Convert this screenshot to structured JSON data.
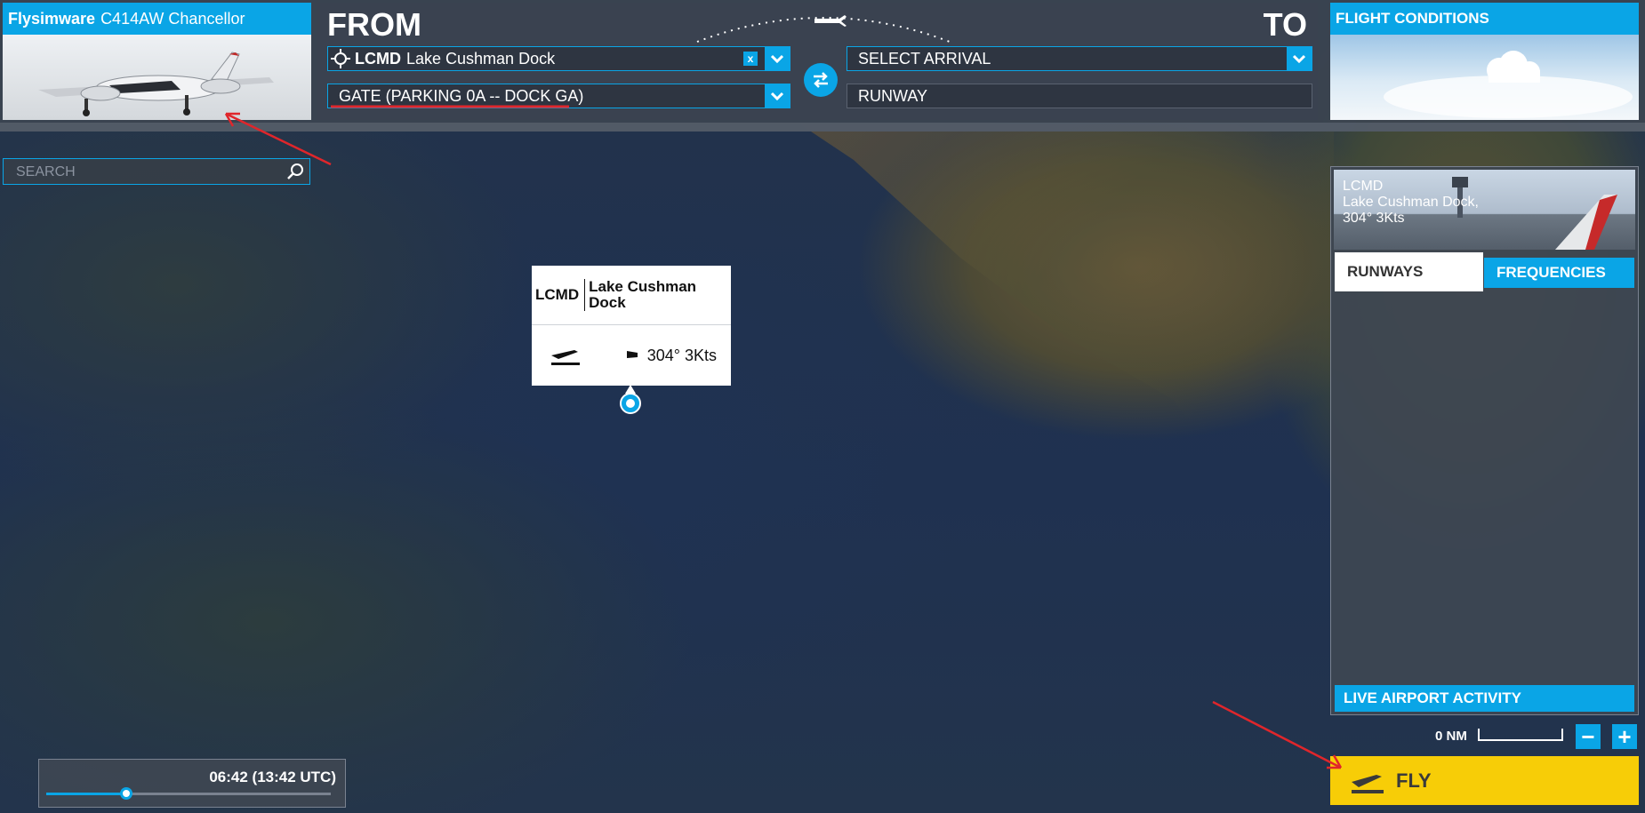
{
  "aircraft": {
    "brand": "Flysimware",
    "model": "C414AW Chancellor"
  },
  "route": {
    "from_label": "FROM",
    "to_label": "TO",
    "departure": {
      "icao": "LCMD",
      "name": "Lake Cushman Dock"
    },
    "departure_gate": "GATE (PARKING 0A -- DOCK GA)",
    "clear_label": "x",
    "arrival_placeholder": "SELECT ARRIVAL",
    "arrival_runway_placeholder": "RUNWAY"
  },
  "flight_conditions": {
    "title": "FLIGHT CONDITIONS"
  },
  "search": {
    "placeholder": "SEARCH"
  },
  "popup": {
    "icao": "LCMD",
    "name_line1": "Lake Cushman",
    "name_line2": "Dock",
    "wind": "304° 3Kts"
  },
  "airport_panel": {
    "icao": "LCMD",
    "name": "Lake Cushman Dock,",
    "wind": "304° 3Kts",
    "tabs": [
      "RUNWAYS",
      "FREQUENCIES"
    ],
    "live_activity": "LIVE AIRPORT ACTIVITY"
  },
  "map": {
    "scale": "0 NM",
    "zoom_out": "−",
    "zoom_in": "+"
  },
  "fly": {
    "label": "FLY"
  },
  "time": {
    "display": "06:42 (13:42 UTC)",
    "slider_value": 0.28
  },
  "colors": {
    "accent": "#0aa5e6",
    "fly": "#f7cd07",
    "annotation": "#e0262b"
  }
}
